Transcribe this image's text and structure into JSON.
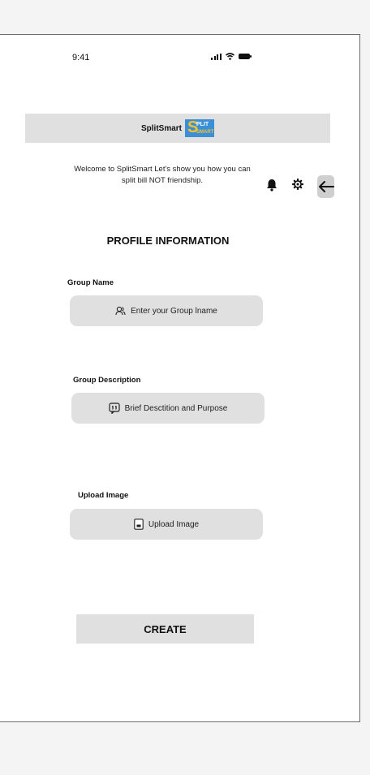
{
  "status_bar": {
    "time": "9:41"
  },
  "header": {
    "app_name": "SplitSmart",
    "logo": {
      "letter": "S",
      "word_top": "PLIT",
      "word_bottom": "SMART"
    }
  },
  "welcome_text": "Welcome to SplitSmart Let's show you how you can split bill NOT friendship.",
  "icons": {
    "bell": "bell-icon",
    "settings": "gear-icon",
    "back": "arrow-left-icon"
  },
  "section_title": "PROFILE INFORMATION",
  "form": {
    "group_name": {
      "label": "Group Name",
      "placeholder": "Enter your Group lname",
      "icon": "user-group-icon"
    },
    "group_description": {
      "label": "Group Description",
      "placeholder": "Brief Desctition and Purpose",
      "icon": "quote-icon"
    },
    "upload_image": {
      "label": "Upload Image",
      "button_label": "Upload Image",
      "icon": "image-icon"
    },
    "create_label": "CREATE"
  },
  "colors": {
    "panel": "#e0e0e0",
    "background": "#ffffff",
    "page": "#f4f4f4",
    "logo_blue": "#3a8fd6",
    "logo_yellow": "#f2c12e"
  }
}
